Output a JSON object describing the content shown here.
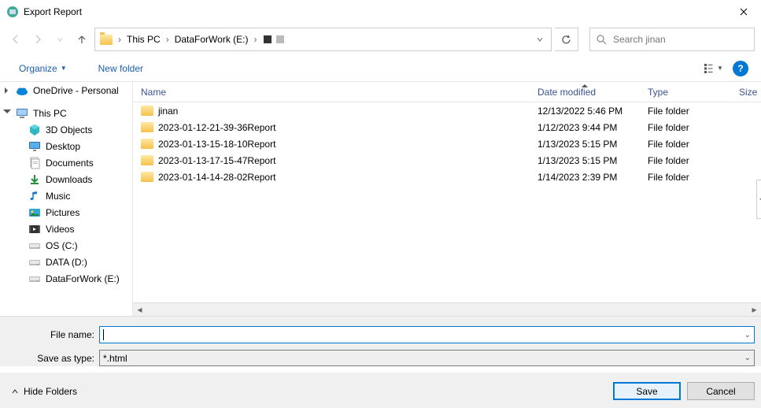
{
  "window": {
    "title": "Export Report"
  },
  "breadcrumbs": {
    "item1": "This PC",
    "item2": "DataForWork (E:)"
  },
  "search": {
    "placeholder": "Search jinan"
  },
  "toolbar": {
    "organize": "Organize",
    "newfolder": "New folder"
  },
  "tree": {
    "onedrive": "OneDrive - Personal",
    "thispc": "This PC",
    "objects3d": "3D Objects",
    "desktop": "Desktop",
    "documents": "Documents",
    "downloads": "Downloads",
    "music": "Music",
    "pictures": "Pictures",
    "videos": "Videos",
    "osc": "OS (C:)",
    "datad": "DATA (D:)",
    "datafw": "DataForWork (E:)"
  },
  "columns": {
    "name": "Name",
    "date": "Date modified",
    "type": "Type",
    "size": "Size"
  },
  "files": [
    {
      "name": "jinan",
      "date": "12/13/2022 5:46 PM",
      "type": "File folder"
    },
    {
      "name": "2023-01-12-21-39-36Report",
      "date": "1/12/2023 9:44 PM",
      "type": "File folder"
    },
    {
      "name": "2023-01-13-15-18-10Report",
      "date": "1/13/2023 5:15 PM",
      "type": "File folder"
    },
    {
      "name": "2023-01-13-17-15-47Report",
      "date": "1/13/2023 5:15 PM",
      "type": "File folder"
    },
    {
      "name": "2023-01-14-14-28-02Report",
      "date": "1/14/2023 2:39 PM",
      "type": "File folder"
    }
  ],
  "form": {
    "filename_label": "File name:",
    "filename_value": "",
    "saveastype_label": "Save as type:",
    "saveastype_value": "*.html"
  },
  "footer": {
    "hidefolders": "Hide Folders",
    "save": "Save",
    "cancel": "Cancel"
  }
}
